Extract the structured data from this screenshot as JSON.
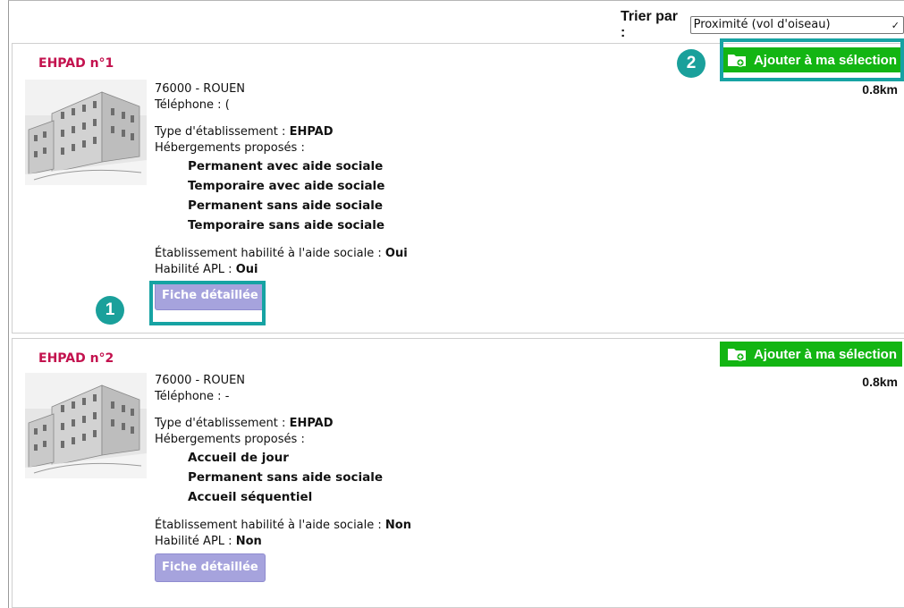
{
  "sort": {
    "label": "Trier par :",
    "selected": "Proximité (vol d'oiseau)"
  },
  "labels": {
    "telephone": "Téléphone :",
    "type": "Type d'établissement :",
    "hebergements": "Hébergements proposés :",
    "aide_sociale": "Établissement habilité à l'aide sociale :",
    "apl": "Habilité APL :",
    "fiche_button": "Fiche détaillée",
    "add_button": "Ajouter à ma sélection"
  },
  "results": [
    {
      "title": "EHPAD n°1",
      "address": "76000 - ROUEN",
      "telephone": "(",
      "type": "EHPAD",
      "hebergements": [
        "Permanent avec aide sociale",
        "Temporaire avec aide sociale",
        "Permanent sans aide sociale",
        "Temporaire sans aide sociale"
      ],
      "aide_sociale": "Oui",
      "apl": "Oui",
      "distance": "0.8km"
    },
    {
      "title": "EHPAD n°2",
      "address": "76000 - ROUEN",
      "telephone": "-",
      "type": "EHPAD",
      "hebergements": [
        "Accueil de jour",
        "Permanent sans aide sociale",
        "Accueil séquentiel"
      ],
      "aide_sociale": "Non",
      "apl": "Non",
      "distance": "0.8km"
    }
  ],
  "annotations": {
    "badge1": "1",
    "badge2": "2"
  },
  "colors": {
    "title": "#c3124e",
    "add_button": "#13b513",
    "fiche_button": "#a6a3dd",
    "highlight": "#16a3a3"
  }
}
